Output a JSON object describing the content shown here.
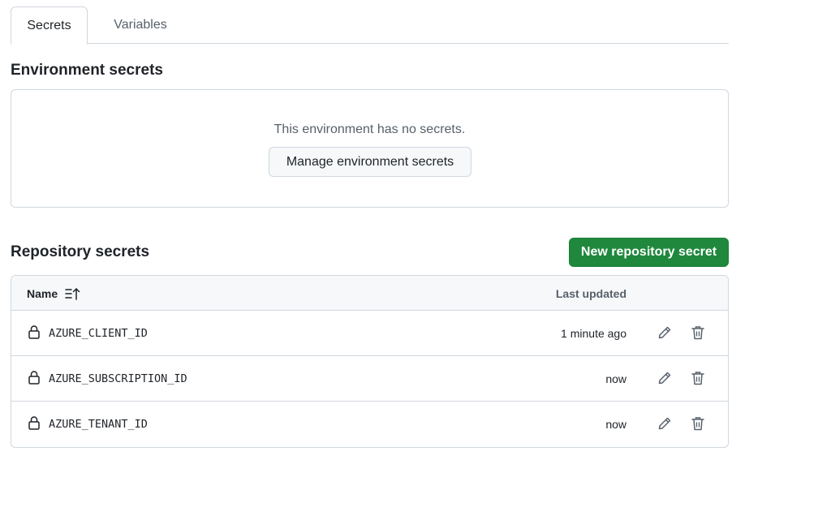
{
  "tabs": [
    {
      "label": "Secrets",
      "active": true
    },
    {
      "label": "Variables",
      "active": false
    }
  ],
  "environment": {
    "title": "Environment secrets",
    "empty_message": "This environment has no secrets.",
    "manage_button": "Manage environment secrets"
  },
  "repository": {
    "title": "Repository secrets",
    "new_button": "New repository secret",
    "columns": {
      "name": "Name",
      "last_updated": "Last updated"
    },
    "secrets": [
      {
        "name": "AZURE_CLIENT_ID",
        "updated": "1 minute ago"
      },
      {
        "name": "AZURE_SUBSCRIPTION_ID",
        "updated": "now"
      },
      {
        "name": "AZURE_TENANT_ID",
        "updated": "now"
      }
    ]
  },
  "icons": {
    "sort": "sort-ascending-icon",
    "lock": "lock-icon",
    "edit": "pencil-icon",
    "delete": "trash-icon"
  },
  "colors": {
    "primary_button": "#1f883d",
    "border": "#d0d7de",
    "muted_text": "#57606a",
    "header_bg": "#f6f8fa"
  }
}
